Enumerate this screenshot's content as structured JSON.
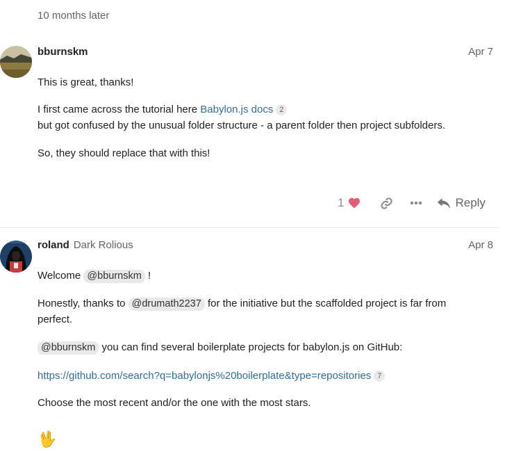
{
  "time_gap": "10 months later",
  "posts": [
    {
      "username": "bburnskm",
      "fullname": "",
      "date": "Apr 7",
      "avatar_icon": "landscape-avatar",
      "paragraphs": {
        "p1": "This is great, thanks!",
        "p2_prefix": "I first came across the tutorial here ",
        "p2_link": "Babylon.js docs",
        "p2_link_count": "2",
        "p2_line2": "but got confused by the unusual folder structure - a parent folder then project subfolders.",
        "p3": "So, they should replace that with this!"
      },
      "likes": "1",
      "reply_label": "Reply"
    },
    {
      "username": "roland",
      "fullname": "Dark Rolious",
      "date": "Apr 8",
      "avatar_icon": "hooded-figure-avatar",
      "paragraphs": {
        "welcome_prefix": "Welcome ",
        "welcome_mention": "@bburnskm",
        "welcome_suffix": " !",
        "p2_prefix": "Honestly, thanks to ",
        "p2_mention": "@drumath2237",
        "p2_suffix": " for the initiative but the scaffolded project is far from perfect.",
        "p3_mention": "@bburnskm",
        "p3_suffix": " you can find several boilerplate projects for babylon.js on GitHub:",
        "p4_link": "https://github.com/search?q=babylonjs%20boilerplate&type=repositories",
        "p4_link_count": "7",
        "p5": "Choose the most recent and/or the one with the most stars.",
        "emoji": "🖖"
      }
    }
  ],
  "colors": {
    "heart": "#e45b74",
    "link": "#2e6e99",
    "muted": "#646464"
  }
}
